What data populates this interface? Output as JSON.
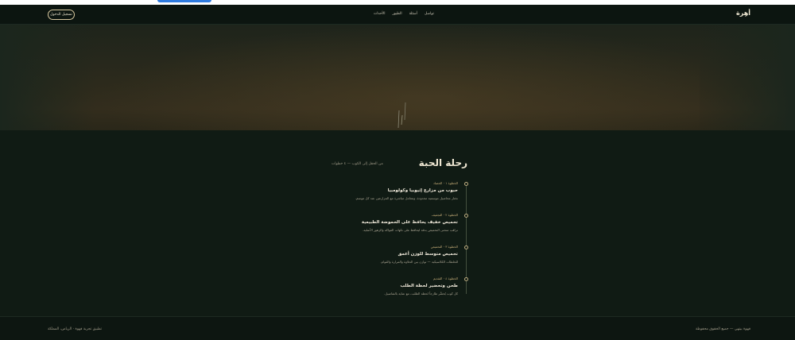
{
  "navbar": {
    "brand": "أهِرة",
    "links": [
      "الأحداث",
      "الطيور",
      "أسئلة",
      "تواصل"
    ],
    "cta_label": "تسجيل الدخول"
  },
  "section": {
    "title": "رحلة الحبة",
    "subtitle": "من الحقل إلى الكوب — ٤ خطوات"
  },
  "timeline": [
    {
      "meta": "الخطوة ١ · الحصاد",
      "title": "حبوب من مزارع إثيوبيا وكولومبيا",
      "desc": "نختار محاصيل موسمية محدودة، ونتعامل مباشرة مع المزارعين عند كل موسم."
    },
    {
      "meta": "الخطوة ٢ · التجفيف",
      "title": "تحميص خفيف يحافظ على الحموضة الطبيعية",
      "desc": "نراقب منحنى التحميص بدقة ليحافظ على نكهات الفواكه والزهور الأصلية."
    },
    {
      "meta": "الخطوة ٣ · التحميص",
      "title": "تحميص متوسط للوزن أعمق",
      "desc": "للخلطات الكلاسيكية — توازن بين الحلاوة والمرارة والقوام."
    },
    {
      "meta": "الخطوة ٤ · التقديم",
      "title": "طحن وتحضير لحظة الطلب",
      "desc": "كل كوب يُحضَّر طازجاً لحظة الطلب، مع عناية بالتفاصيل."
    }
  ],
  "footer": {
    "right_text": "قهوة بيتهي — جميع الحقوق محفوظة",
    "left_text": "تطبيق تجربة قهوة · الرياض، المملكة"
  },
  "colors": {
    "background": "#101b14",
    "accent": "#c9b07a"
  }
}
